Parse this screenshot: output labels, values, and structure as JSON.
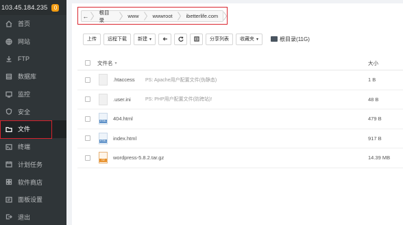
{
  "server": {
    "ip": "103.45.184.235",
    "badge": "0"
  },
  "sidebar": {
    "items": [
      {
        "label": "首页",
        "icon": "home-icon"
      },
      {
        "label": "网站",
        "icon": "globe-icon"
      },
      {
        "label": "FTP",
        "icon": "ftp-icon"
      },
      {
        "label": "数据库",
        "icon": "database-icon"
      },
      {
        "label": "监控",
        "icon": "monitor-icon"
      },
      {
        "label": "安全",
        "icon": "shield-icon"
      },
      {
        "label": "文件",
        "icon": "folder-icon",
        "active": true
      },
      {
        "label": "终端",
        "icon": "terminal-icon"
      },
      {
        "label": "计划任务",
        "icon": "calendar-icon"
      },
      {
        "label": "软件商店",
        "icon": "store-icon"
      },
      {
        "label": "面板设置",
        "icon": "settings-icon"
      },
      {
        "label": "退出",
        "icon": "logout-icon"
      }
    ]
  },
  "breadcrumb": {
    "items": [
      "根目录",
      "www",
      "wwwroot",
      "ibetterlife.com"
    ]
  },
  "toolbar": {
    "upload": "上传",
    "remote_download": "远程下载",
    "new": "新建",
    "share_list": "分享列表",
    "favorites": "收藏夹",
    "root_info": "根目录(11G)"
  },
  "table": {
    "col_name": "文件名",
    "col_size": "大小",
    "rows": [
      {
        "name": ".htaccess",
        "note": "PS: Apache用户配置文件(伪静态)",
        "size": "1 B",
        "type": "blank"
      },
      {
        "name": ".user.ini",
        "note": "PS: PHP用户配置文件(防跨站)!",
        "size": "48 B",
        "type": "blank"
      },
      {
        "name": "404.html",
        "note": "",
        "size": "479 B",
        "type": "html"
      },
      {
        "name": "index.html",
        "note": "",
        "size": "917 B",
        "type": "html"
      },
      {
        "name": "wordpress-5.8.2.tar.gz",
        "note": "",
        "size": "14.39 MB",
        "type": "gz"
      }
    ]
  }
}
